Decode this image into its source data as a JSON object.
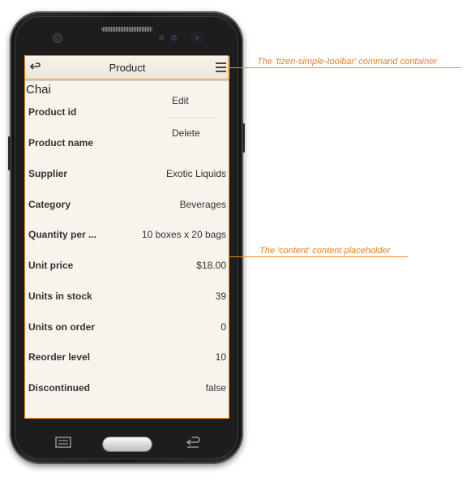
{
  "toolbar": {
    "back_icon": "back-arrow-icon",
    "title": "Product",
    "menu_icon": "hamburger-menu-icon"
  },
  "record_title": "Chai",
  "context_menu": {
    "edit_label": "Edit",
    "delete_label": "Delete"
  },
  "details": [
    {
      "label": "Product id",
      "value": ""
    },
    {
      "label": "Product name",
      "value": ""
    },
    {
      "label": "Supplier",
      "value": "Exotic Liquids"
    },
    {
      "label": "Category",
      "value": "Beverages"
    },
    {
      "label": "Quantity per ...",
      "value": "10 boxes x 20 bags"
    },
    {
      "label": "Unit price",
      "value": "$18.00"
    },
    {
      "label": "Units in stock",
      "value": "39"
    },
    {
      "label": "Units on order",
      "value": "0"
    },
    {
      "label": "Reorder level",
      "value": "10"
    },
    {
      "label": "Discontinued",
      "value": "false"
    }
  ],
  "annotations": {
    "toolbar_note": "The 'tizen-simple-toolbar' command container",
    "content_note": "The 'content' content placeholder"
  },
  "colors": {
    "annotation": "#f08a1c",
    "screen_bg": "#f8f4ec",
    "phone_body": "#1d1d1d"
  },
  "nav_icons": {
    "menu": "menu-lines-icon",
    "home": "home-button",
    "back": "return-arrow-icon"
  }
}
